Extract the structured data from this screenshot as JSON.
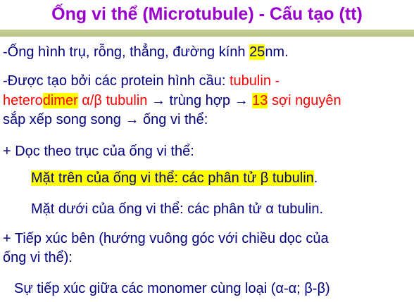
{
  "slide": {
    "title": "Ống vi thể (Microtubule) - Cấu tạo (tt)",
    "line1": {
      "a": "-Ống hình trụ, rỗng, thẳng, đường kính ",
      "hl": "25",
      "b": "nm."
    },
    "line2": {
      "a": "-Được tạo bởi các protein hình cầu: ",
      "red": "tubulin -"
    },
    "line3": {
      "red1": "hetero",
      "red_hl": "dimer",
      "red2": " α/β tubulin",
      "a": " → trùng hợp → ",
      "hl": "13",
      "red3": " sợi nguyên"
    },
    "line4": "sắp xếp song song → ống vi thể:",
    "line5": "+ Dọc theo trục của ống vi thể:",
    "line6": {
      "hl": "Mặt trên của ống vi thể: các phân tử β tubulin",
      "b": "."
    },
    "line7": "Mặt dưới của ống vi thể: các phân tử α tubulin.",
    "line8": "+ Tiếp xúc bên (hướng vuông góc với chiều dọc của",
    "line9": "ống vi thể):",
    "line10": "Sự tiếp xúc giữa các monomer cùng loại (α-α; β-β)"
  }
}
